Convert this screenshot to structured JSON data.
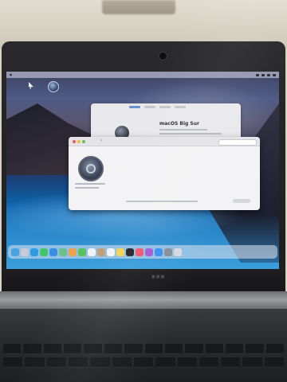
{
  "image": {
    "subject": "photo of a laptop screen"
  },
  "screen": {
    "menubar": {
      "app_menu": "",
      "items": [
        "",
        "",
        "",
        ""
      ]
    },
    "about_window": {
      "os_name": "macOS Big Sur"
    },
    "update_window": {
      "title": "",
      "message_line1": "",
      "message_line2": ""
    },
    "dock": {
      "icons": [
        {
          "name": "finder-icon",
          "color": "#4aa3df"
        },
        {
          "name": "launchpad-icon",
          "color": "#c9ccd6"
        },
        {
          "name": "safari-icon",
          "color": "#2f9be0"
        },
        {
          "name": "messages-icon",
          "color": "#47c46a"
        },
        {
          "name": "mail-icon",
          "color": "#3a8fe0"
        },
        {
          "name": "maps-icon",
          "color": "#6cc08a"
        },
        {
          "name": "photos-icon",
          "color": "#f0a04b"
        },
        {
          "name": "facetime-icon",
          "color": "#54c15e"
        },
        {
          "name": "calendar-icon",
          "color": "#f2f2f4"
        },
        {
          "name": "contacts-icon",
          "color": "#c59c77"
        },
        {
          "name": "reminders-icon",
          "color": "#f3f3f5"
        },
        {
          "name": "notes-icon",
          "color": "#f4d154"
        },
        {
          "name": "tv-icon",
          "color": "#23252b"
        },
        {
          "name": "music-icon",
          "color": "#f2546e"
        },
        {
          "name": "podcasts-icon",
          "color": "#a45bd6"
        },
        {
          "name": "app-store-icon",
          "color": "#3b8ff0"
        },
        {
          "name": "system-preferences-icon",
          "color": "#8a8d96"
        },
        {
          "name": "trash-icon",
          "color": "#d7d9df"
        }
      ]
    }
  },
  "colors": {
    "bezel": "#1c1c1e",
    "ocean": "#0e5fa6",
    "window_bg": "#f3f3f5",
    "traffic_red": "#ee5b52",
    "traffic_yellow": "#f2bc3c",
    "traffic_green": "#5fc34f"
  }
}
